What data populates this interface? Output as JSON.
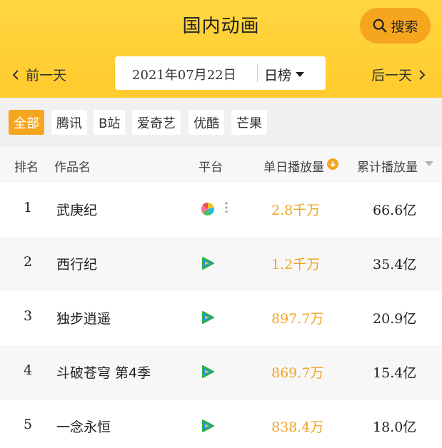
{
  "header": {
    "title": "国内动画",
    "search_label": "搜索",
    "prev_label": "前一天",
    "next_label": "后一天",
    "date": "2021年07月22日",
    "range": "日榜"
  },
  "filters": [
    {
      "label": "全部",
      "active": true
    },
    {
      "label": "腾讯",
      "active": false
    },
    {
      "label": "B站",
      "active": false
    },
    {
      "label": "爱奇艺",
      "active": false
    },
    {
      "label": "优酷",
      "active": false
    },
    {
      "label": "芒果",
      "active": false
    }
  ],
  "table": {
    "headers": {
      "rank": "排名",
      "name": "作品名",
      "platform": "平台",
      "daily": "单日播放量",
      "total": "累计播放量"
    },
    "rows": [
      {
        "rank": "1",
        "name": "武庚纪",
        "platform": "multi-platform-icon",
        "daily": "2.8千万",
        "total": "66.6亿"
      },
      {
        "rank": "2",
        "name": "西行纪",
        "platform": "tencent-video-icon",
        "daily": "1.2千万",
        "total": "35.4亿"
      },
      {
        "rank": "3",
        "name": "独步逍遥",
        "platform": "tencent-video-icon",
        "daily": "897.7万",
        "total": "20.9亿"
      },
      {
        "rank": "4",
        "name": "斗破苍穹 第4季",
        "platform": "tencent-video-icon",
        "daily": "869.7万",
        "total": "15.4亿"
      },
      {
        "rank": "5",
        "name": "一念永恒",
        "platform": "tencent-video-icon",
        "daily": "838.4万",
        "total": "18.0亿"
      }
    ]
  },
  "colors": {
    "header_bg": "#ffd23a",
    "accent": "#f6a51f",
    "daily_value": "#f2a424"
  }
}
